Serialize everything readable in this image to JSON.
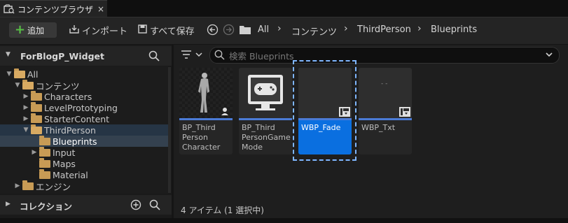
{
  "tab": {
    "title": "コンテンツブラウザ",
    "close": "×"
  },
  "toolbar": {
    "add_label": "追加",
    "import_label": "インポート",
    "save_all_label": "すべて保存",
    "breadcrumb": [
      "All",
      "コンテンツ",
      "ThirdPerson",
      "Blueprints"
    ],
    "separator": "›"
  },
  "left_panel": {
    "title": "ForBlogP_Widget",
    "tree": [
      {
        "label": "All",
        "indent": 0,
        "arrow": "▼",
        "open": true
      },
      {
        "label": "コンテンツ",
        "indent": 1,
        "arrow": "▼",
        "open": true
      },
      {
        "label": "Characters",
        "indent": 2,
        "arrow": "▶",
        "open": false
      },
      {
        "label": "LevelPrototyping",
        "indent": 2,
        "arrow": "▶",
        "open": false
      },
      {
        "label": "StarterContent",
        "indent": 2,
        "arrow": "▶",
        "open": false
      },
      {
        "label": "ThirdPerson",
        "indent": 2,
        "arrow": "▼",
        "open": true
      },
      {
        "label": "Blueprints",
        "indent": 3,
        "arrow": "",
        "open": false
      },
      {
        "label": "Input",
        "indent": 3,
        "arrow": "▶",
        "open": false
      },
      {
        "label": "Maps",
        "indent": 3,
        "arrow": "",
        "open": false
      },
      {
        "label": "Material",
        "indent": 3,
        "arrow": "",
        "open": false
      },
      {
        "label": "エンジン",
        "indent": 1,
        "arrow": "▶",
        "open": false
      }
    ],
    "collections_label": "コレクション"
  },
  "right_panel": {
    "search_placeholder": "検索 Blueprints",
    "assets": [
      {
        "label": "BP_Third Person Character"
      },
      {
        "label": "BP_Third PersonGame Mode"
      },
      {
        "label": "WBP_Fade"
      },
      {
        "label": "WBP_Txt"
      }
    ],
    "txt_preview": "- -",
    "status": "4 アイテム (1 選択中)"
  },
  "colors": {
    "accent": "#0a6fe0",
    "selection": "#34414f",
    "add_plus": "#58c046",
    "folder": "#c89b55"
  },
  "icons": [
    "content-browser-icon",
    "close-icon",
    "plus-icon",
    "import-icon",
    "save-icon",
    "back-icon",
    "forward-icon",
    "folder-icon",
    "search-icon",
    "filter-icon",
    "chevron-down-icon",
    "add-circle-icon",
    "widget-blueprint-icon"
  ]
}
